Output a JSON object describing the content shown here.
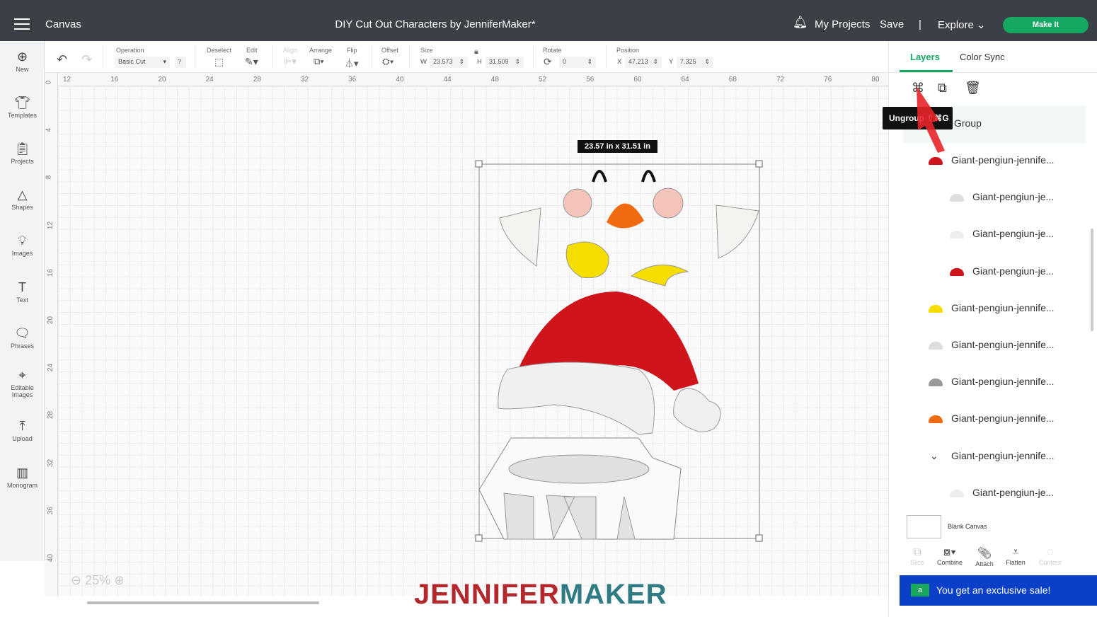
{
  "topbar": {
    "app": "Canvas",
    "title": "DIY Cut Out Characters by JenniferMaker*",
    "notifications": "bell-icon",
    "my_projects": "My Projects",
    "save": "Save",
    "divider": "|",
    "explore": "Explore",
    "make_it": "Make It"
  },
  "sidebar": {
    "items": [
      {
        "label": "New",
        "icon": "plus-circle"
      },
      {
        "label": "Templates",
        "icon": "shirt"
      },
      {
        "label": "Projects",
        "icon": "clipboard"
      },
      {
        "label": "Shapes",
        "icon": "shapes"
      },
      {
        "label": "Images",
        "icon": "bulb"
      },
      {
        "label": "Text",
        "icon": "T"
      },
      {
        "label": "Phrases",
        "icon": "speech"
      },
      {
        "label": "Editable Images",
        "icon": "editable"
      },
      {
        "label": "Upload",
        "icon": "upload"
      },
      {
        "label": "Monogram",
        "icon": "monogram"
      }
    ]
  },
  "toolbar": {
    "operation_label": "Operation",
    "operation_value": "Basic Cut",
    "help": "?",
    "deselect": "Deselect",
    "edit": "Edit",
    "align": "Align",
    "arrange": "Arrange",
    "flip": "Flip",
    "offset": "Offset",
    "size": "Size",
    "w_label": "W",
    "w": "23.573",
    "h_label": "H",
    "h": "31.509",
    "rotate": "Rotate",
    "rotate_value": "0",
    "position": "Position",
    "x_label": "X",
    "x": "47.213",
    "y_label": "Y",
    "y": "7.325"
  },
  "ruler": {
    "h": [
      "12",
      "16",
      "20",
      "24",
      "28",
      "32",
      "36",
      "40",
      "44",
      "48",
      "52",
      "56",
      "60",
      "64",
      "68",
      "72",
      "76",
      "80"
    ],
    "v": [
      "0",
      "4",
      "8",
      "12",
      "16",
      "20",
      "24",
      "28",
      "32",
      "36",
      "40"
    ]
  },
  "canvas": {
    "dimension_label": "23.57  in x 31.51  in",
    "zoom": "25%"
  },
  "panel": {
    "tabs": [
      "Layers",
      "Color Sync"
    ],
    "tooltip": "Ungroup ⇧⌘G",
    "group_label": "Group",
    "layers": [
      "Giant-pengiun-jennife...",
      "Giant-pengiun-je...",
      "Giant-pengiun-je...",
      "Giant-pengiun-je...",
      "Giant-pengiun-jennife...",
      "Giant-pengiun-jennife...",
      "Giant-pengiun-jennife...",
      "Giant-pengiun-jennife...",
      "Giant-pengiun-jennife...",
      "Giant-pengiun-je..."
    ],
    "blank_canvas": "Blank Canvas",
    "actions": [
      "Slice",
      "Combine",
      "Attach",
      "Flatten",
      "Contour"
    ]
  },
  "sale": "You get an exclusive sale!",
  "watermark": "JENNIFERMAKER",
  "colors": {
    "accent": "#14a862",
    "topbar": "#3b3f46",
    "sale": "#0a3fc8",
    "hat": "#d0141c",
    "beak": "#f26a10"
  }
}
